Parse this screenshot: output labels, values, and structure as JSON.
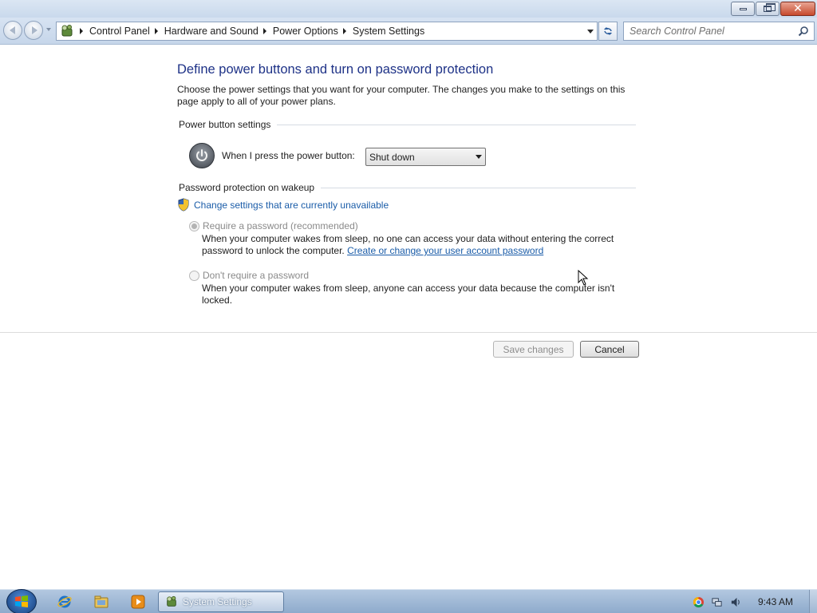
{
  "window": {
    "minimize_icon": "minimize-icon",
    "maximize_icon": "restore-icon",
    "close_icon": "close-icon"
  },
  "address_bar": {
    "root_icon": "control-panel-icon",
    "breadcrumbs": [
      "Control Panel",
      "Hardware and Sound",
      "Power Options",
      "System Settings"
    ]
  },
  "search": {
    "placeholder": "Search Control Panel"
  },
  "page": {
    "title": "Define power buttons and turn on password protection",
    "intro": "Choose the power settings that you want for your computer. The changes you make to the settings on this page apply to all of your power plans."
  },
  "power_section": {
    "header": "Power button settings",
    "label": "When I press the power button:",
    "selected": "Shut down"
  },
  "password_section": {
    "header": "Password protection on wakeup",
    "change_link": "Change settings that are currently unavailable",
    "options": [
      {
        "label": "Require a password (recommended)",
        "checked": true,
        "enabled": false,
        "desc_before_link": "When your computer wakes from sleep, no one can access your data without entering the correct password to unlock the computer. ",
        "link": "Create or change your user account password"
      },
      {
        "label": "Don't require a password",
        "checked": false,
        "enabled": false,
        "desc": "When your computer wakes from sleep, anyone can access your data because the computer isn't locked."
      }
    ]
  },
  "buttons": {
    "save": "Save changes",
    "cancel": "Cancel"
  },
  "taskbar": {
    "task": "System Settings",
    "clock": "9:43 AM"
  }
}
